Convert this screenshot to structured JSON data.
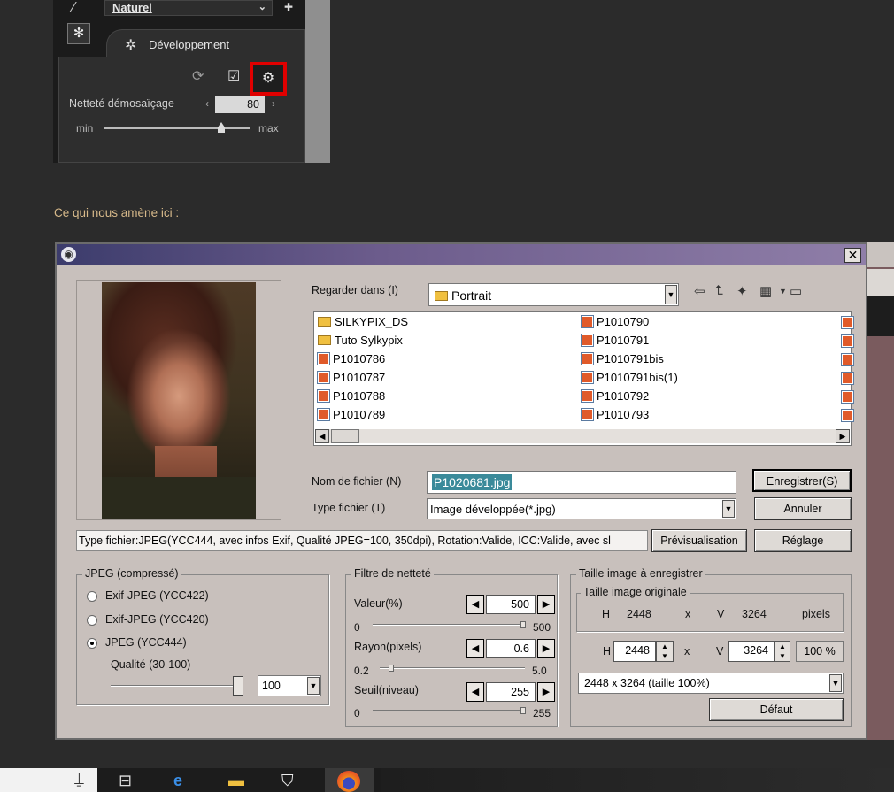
{
  "top_panel": {
    "preset_value": "Naturel",
    "tab_label": "Développement",
    "sharpness_label": "Netteté démosaïçage",
    "sharpness_value": "80",
    "slider_min": "min",
    "slider_max": "max",
    "sharpness_fraction": 0.8
  },
  "caption": "Ce qui nous amène ici :",
  "dialog": {
    "lookin_label": "Regarder dans (I)",
    "lookin_value": "Portrait",
    "files_col1": [
      "SILKYPIX_DS",
      "Tuto Sylkypix",
      "P1010786",
      "P1010787",
      "P1010788",
      "P1010789"
    ],
    "files_col1_types": [
      "folder",
      "folder",
      "file",
      "file",
      "file",
      "file"
    ],
    "files_col2": [
      "P1010790",
      "P1010791",
      "P1010791bis",
      "P1010791bis(1)",
      "P1010792",
      "P1010793"
    ],
    "filename_label": "Nom de fichier (N)",
    "filename_value": "P1020681.jpg",
    "filetype_label": "Type fichier (T)",
    "filetype_value": "Image développée(*.jpg)",
    "save_button": "Enregistrer(S)",
    "cancel_button": "Annuler",
    "info_text": "Type fichier:JPEG(YCC444, avec infos Exif, Qualité JPEG=100, 350dpi), Rotation:Valide, ICC:Valide, avec sl",
    "preview_button": "Prévisualisation",
    "settings_button": "Réglage",
    "jpeg_group": {
      "legend": "JPEG (compressé)",
      "options": [
        "Exif-JPEG  (YCC422)",
        "Exif-JPEG  (YCC420)",
        "JPEG  (YCC444)"
      ],
      "selected_index": 2,
      "quality_label": "Qualité (30-100)",
      "quality_value": "100",
      "quality_fraction": 1.0
    },
    "sharpen_group": {
      "legend": "Filtre de netteté",
      "value_label": "Valeur(%)",
      "value": "500",
      "value_min": "0",
      "value_max": "500",
      "radius_label": "Rayon(pixels)",
      "radius": "0.6",
      "radius_min": "0.2",
      "radius_max": "5.0",
      "threshold_label": "Seuil(niveau)",
      "threshold": "255",
      "threshold_min": "0",
      "threshold_max": "255"
    },
    "size_group": {
      "legend": "Taille image à enregistrer",
      "orig_legend": "Taille image originale",
      "orig_h_label": "H",
      "orig_h": "2448",
      "x_label": "x",
      "orig_v_label": "V",
      "orig_v": "3264",
      "unit": "pixels",
      "h_label": "H",
      "h_value": "2448",
      "v_label": "V",
      "v_value": "3264",
      "percent": "100 %",
      "size_combo": "2448 x  3264  (taille 100%)",
      "default_button": "Défaut"
    }
  }
}
